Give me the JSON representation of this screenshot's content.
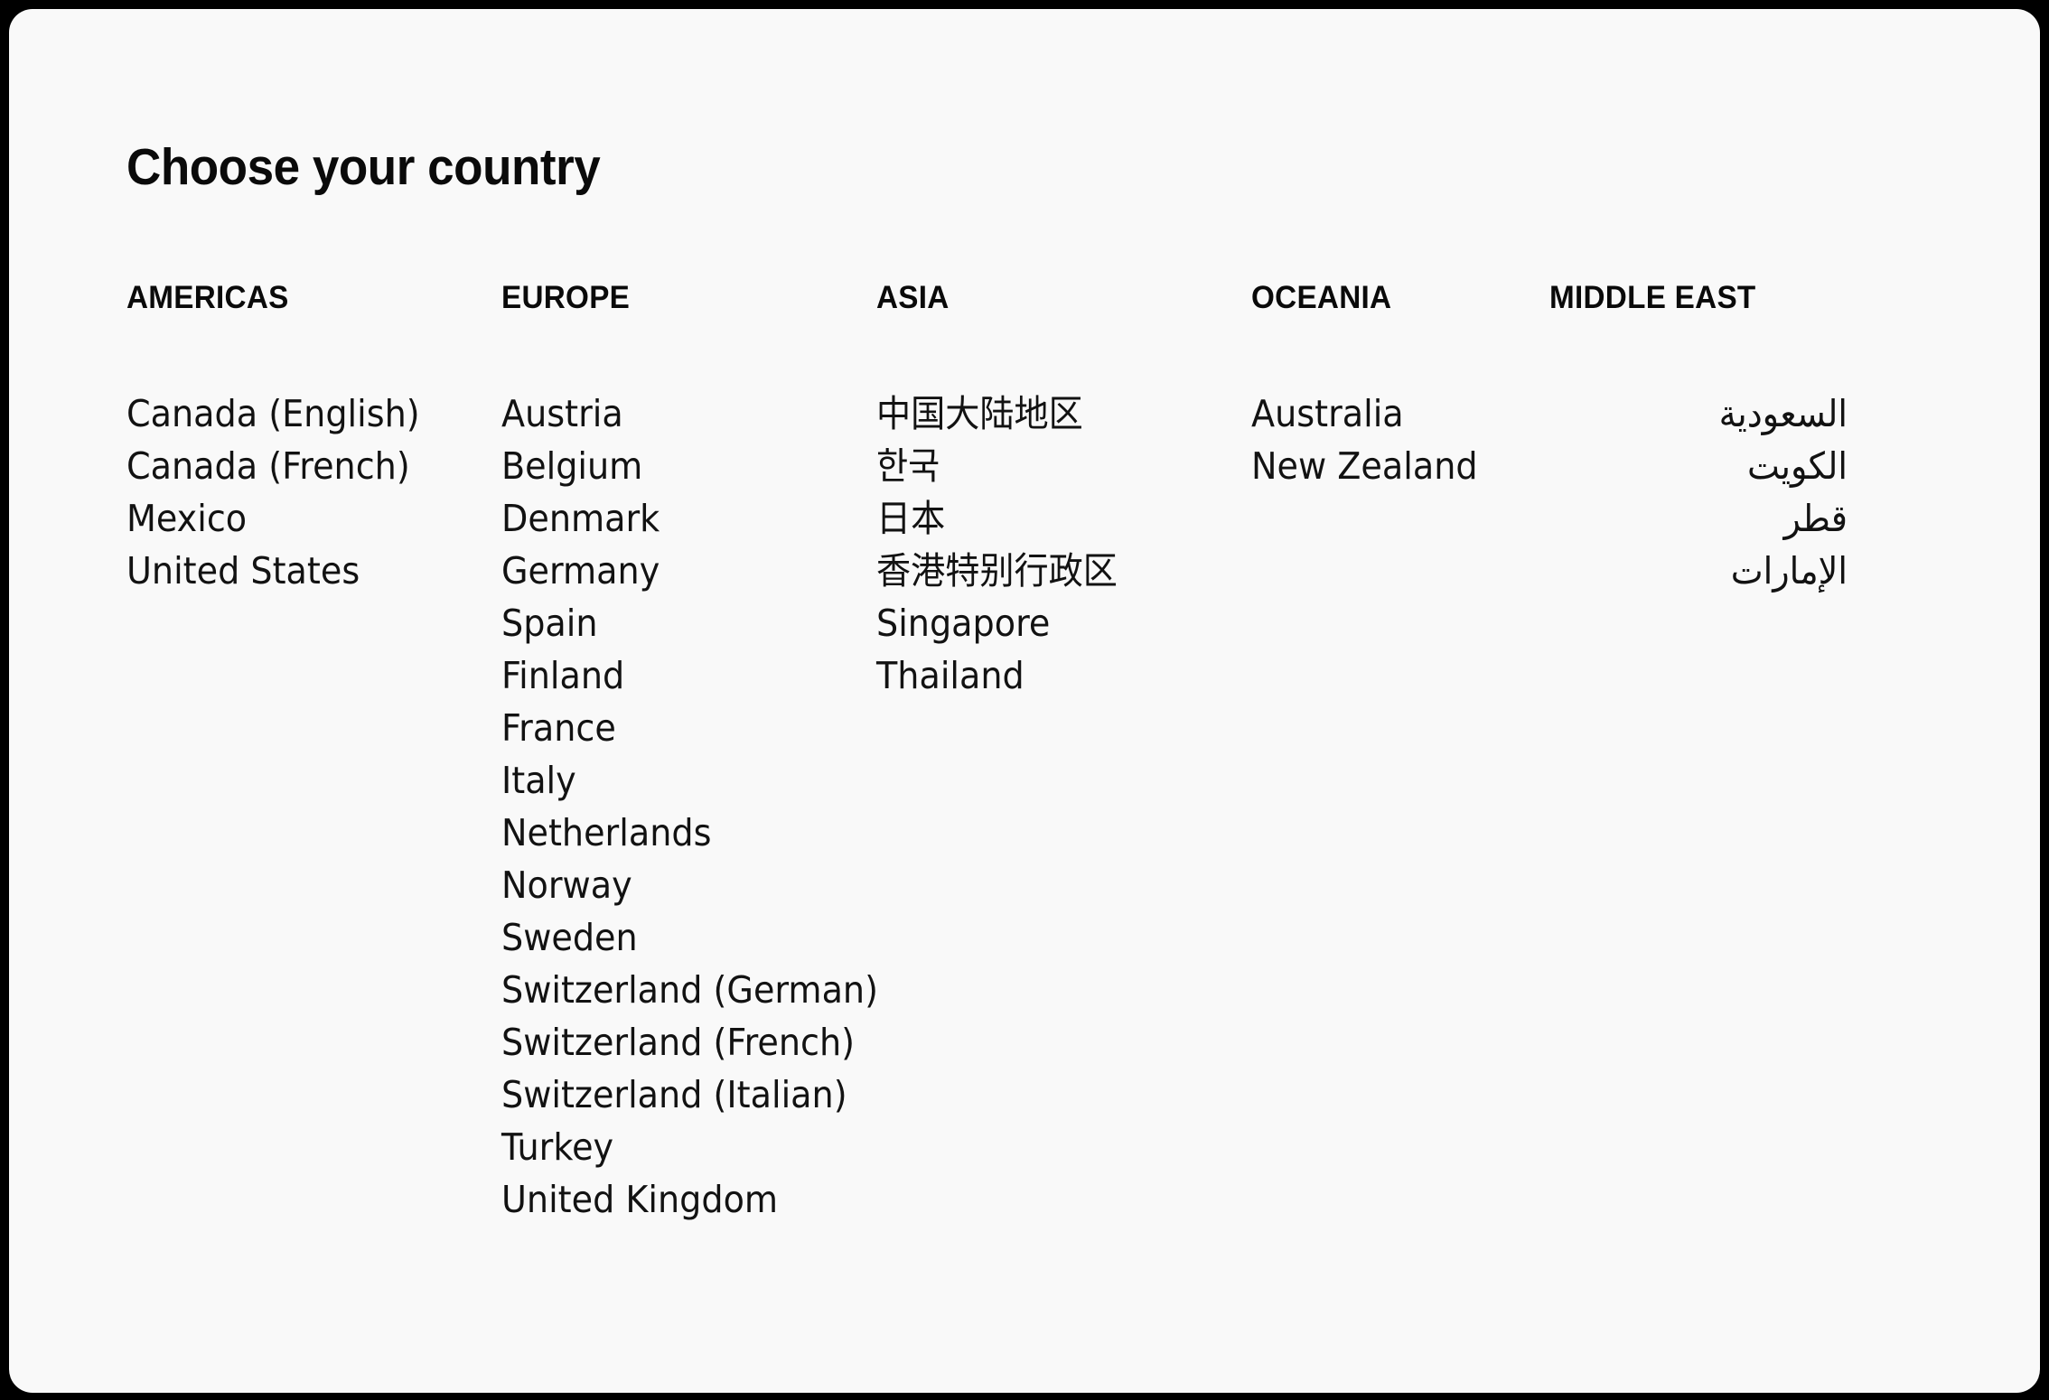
{
  "page": {
    "title": "Choose your country",
    "background_color": "#000000",
    "card_color": "#f9f9f9",
    "text_color": "#121212"
  },
  "columns": [
    {
      "header": "AMERICAS",
      "items": [
        "Canada (English)",
        "Canada (French)",
        "Mexico",
        "United States"
      ]
    },
    {
      "header": "EUROPE",
      "items": [
        "Austria",
        "Belgium",
        "Denmark",
        "Germany",
        "Spain",
        "Finland",
        "France",
        "Italy",
        "Netherlands",
        "Norway",
        "Sweden",
        "Switzerland (German)",
        "Switzerland (French)",
        "Switzerland (Italian)",
        "Turkey",
        "United Kingdom"
      ]
    },
    {
      "header": "ASIA",
      "items": [
        "中国大陆地区",
        "한국",
        "日本",
        "香港特别行政区",
        "Singapore",
        "Thailand"
      ]
    },
    {
      "header": "OCEANIA",
      "items": [
        "Australia",
        "New Zealand"
      ]
    },
    {
      "header": "MIDDLE EAST",
      "items": [
        "السعودية",
        "الكويت",
        "قطر",
        "الإمارات"
      ]
    }
  ]
}
